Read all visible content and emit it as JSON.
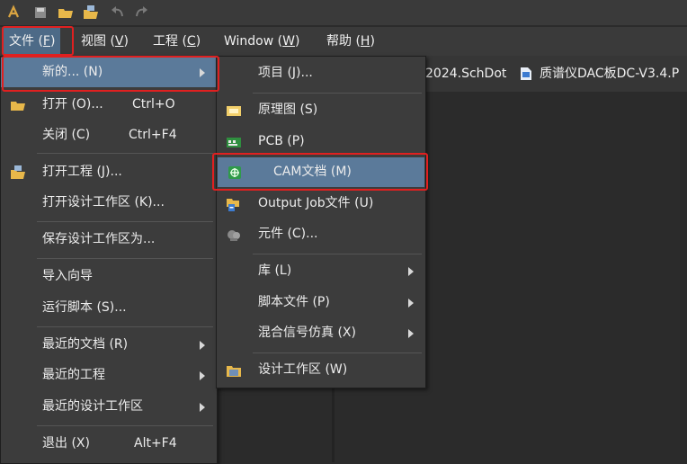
{
  "menubar": {
    "items": [
      {
        "label": "文件 (",
        "key": "F",
        "end": ")"
      },
      {
        "label": "视图 (",
        "key": "V",
        "end": ")"
      },
      {
        "label": "工程 (",
        "key": "C",
        "end": ")"
      },
      {
        "label": "Window (",
        "key": "W",
        "end": ")"
      },
      {
        "label": "帮助 (",
        "key": "H",
        "end": ")"
      }
    ]
  },
  "tabs": [
    {
      "label": "2024.SchDot"
    },
    {
      "label": "质谱仪DAC板DC-V3.4.P"
    }
  ],
  "file_menu": {
    "items": [
      {
        "label": "新的... (N)",
        "shortcut": ""
      },
      {
        "label": "打开 (O)...",
        "shortcut": "Ctrl+O"
      },
      {
        "label": "关闭 (C)",
        "shortcut": "Ctrl+F4"
      },
      {
        "label": "打开工程 (J)...",
        "shortcut": ""
      },
      {
        "label": "打开设计工作区 (K)...",
        "shortcut": ""
      },
      {
        "label": "保存设计工作区为...",
        "shortcut": ""
      },
      {
        "label": "导入向导",
        "shortcut": ""
      },
      {
        "label": "运行脚本 (S)...",
        "shortcut": ""
      },
      {
        "label": "最近的文档 (R)",
        "shortcut": ""
      },
      {
        "label": "最近的工程",
        "shortcut": ""
      },
      {
        "label": "最近的设计工作区",
        "shortcut": ""
      },
      {
        "label": "退出 (X)",
        "shortcut": "Alt+F4"
      }
    ]
  },
  "new_submenu": {
    "items": [
      {
        "label": "项目 (J)..."
      },
      {
        "label": "原理图 (S)"
      },
      {
        "label": "PCB (P)"
      },
      {
        "label": "CAM文档 (M)"
      },
      {
        "label": "Output Job文件 (U)"
      },
      {
        "label": "元件 (C)..."
      },
      {
        "label": "库 (L)"
      },
      {
        "label": "脚本文件 (P)"
      },
      {
        "label": "混合信号仿真 (X)"
      },
      {
        "label": "设计工作区 (W)"
      }
    ]
  },
  "colors": {
    "highlight": "#5b7a9a",
    "annotation": "#e02020"
  }
}
